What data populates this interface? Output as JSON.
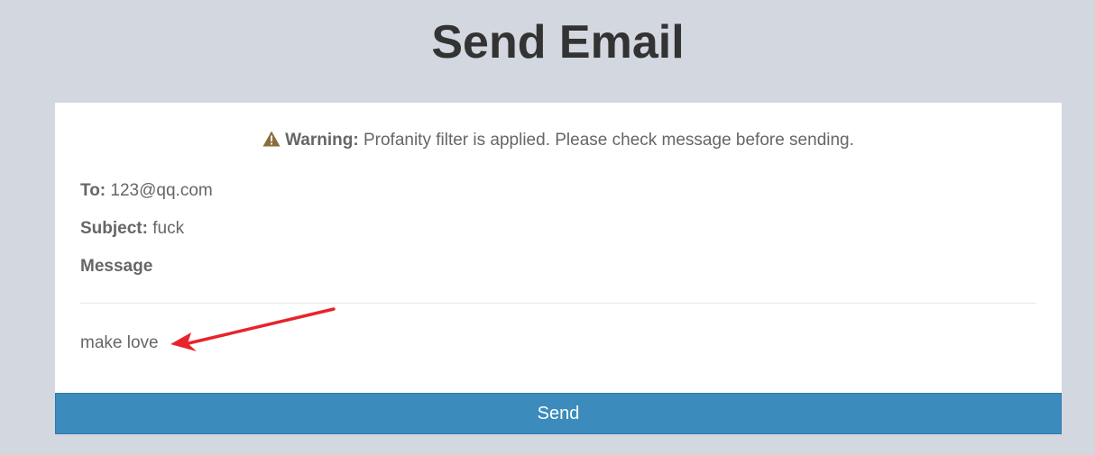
{
  "page": {
    "title": "Send Email"
  },
  "warning": {
    "icon": "warning-triangle-icon",
    "label": "Warning:",
    "text": "Profanity filter is applied. Please check message before sending.",
    "icon_color": "#8a6d3b"
  },
  "email": {
    "to_label": "To:",
    "to_value": "123@qq.com",
    "subject_label": "Subject:",
    "subject_value": "fuck",
    "message_label": "Message",
    "message_body": "make love"
  },
  "annotation": {
    "icon": "red-arrow-icon",
    "color": "#e8232b"
  },
  "actions": {
    "send_label": "Send",
    "send_color": "#3b8bbd"
  }
}
